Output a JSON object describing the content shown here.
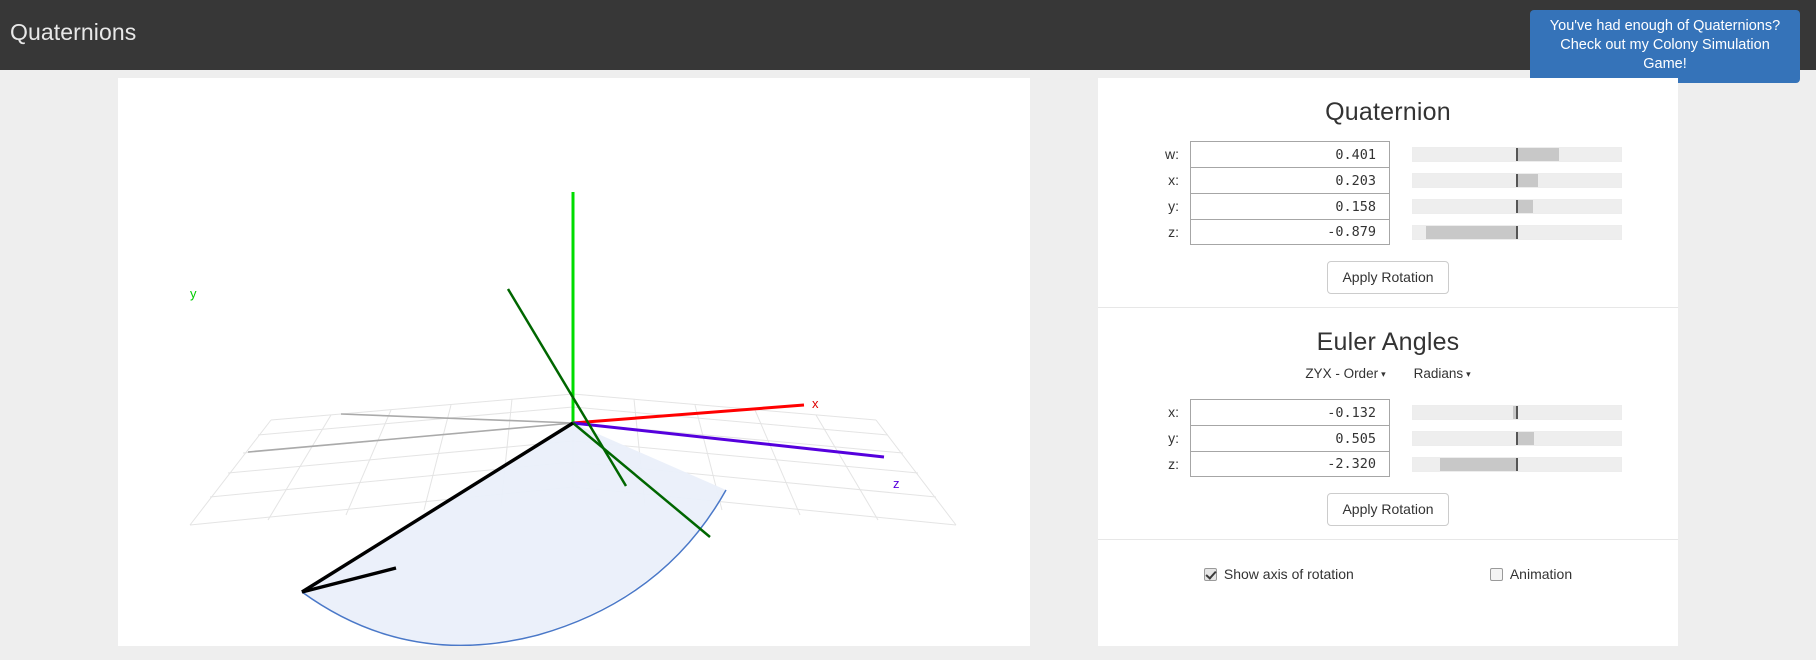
{
  "navbar": {
    "title": "Quaternions",
    "promo": {
      "line1": "You've had enough of Quaternions?",
      "line2": "Check out my Colony Simulation Game!",
      "color": "#3573b9"
    }
  },
  "viewport": {
    "axis_labels": {
      "x": "x",
      "y": "y",
      "z": "z"
    },
    "axis_colors": {
      "x": "#ff0000",
      "y": "#00dd00",
      "z": "#5500dd",
      "rotated_axis": "#006600",
      "rotation_axis": "#000000",
      "arc": "#4a78c8",
      "sector_fill": "#eaeffa",
      "grid": "#e2e2e2"
    }
  },
  "quaternion": {
    "title": "Quaternion",
    "fields": [
      {
        "label": "w:",
        "value": "0.401",
        "slider_min": -1,
        "slider_max": 1,
        "slider_value": 0.401
      },
      {
        "label": "x:",
        "value": "0.203",
        "slider_min": -1,
        "slider_max": 1,
        "slider_value": 0.203
      },
      {
        "label": "y:",
        "value": "0.158",
        "slider_min": -1,
        "slider_max": 1,
        "slider_value": 0.158
      },
      {
        "label": "z:",
        "value": "-0.879",
        "slider_min": -1,
        "slider_max": 1,
        "slider_value": -0.879
      }
    ],
    "apply_label": "Apply Rotation"
  },
  "euler": {
    "title": "Euler Angles",
    "order_dropdown": {
      "label": "ZYX - Order",
      "caret": "▾"
    },
    "unit_dropdown": {
      "label": "Radians",
      "caret": "▾"
    },
    "fields": [
      {
        "label": "x:",
        "value": "-0.132",
        "slider_min": -3.1416,
        "slider_max": 3.1416,
        "slider_value": -0.132
      },
      {
        "label": "y:",
        "value": "0.505",
        "slider_min": -3.1416,
        "slider_max": 3.1416,
        "slider_value": 0.505
      },
      {
        "label": "z:",
        "value": "-2.320",
        "slider_min": -3.1416,
        "slider_max": 3.1416,
        "slider_value": -2.32
      }
    ],
    "apply_label": "Apply Rotation"
  },
  "options": [
    {
      "label": "Show axis of rotation",
      "checked": true
    },
    {
      "label": "Animation",
      "checked": false
    }
  ]
}
